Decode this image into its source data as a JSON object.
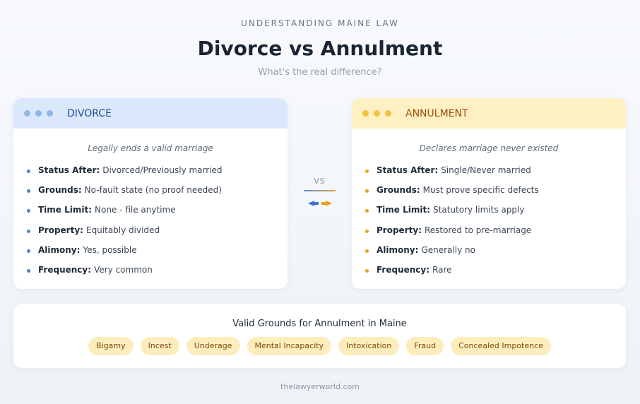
{
  "header": {
    "eyebrow": "UNDERSTANDING MAINE LAW",
    "title": "Divorce vs Annulment",
    "subtitle": "What's the real difference?"
  },
  "divorce": {
    "name": "DIVORCE",
    "tagline": "Legally ends a valid marriage",
    "rows": [
      {
        "label": "Status After",
        "value": "Divorced/Previously married"
      },
      {
        "label": "Grounds",
        "value": "No-fault state (no proof needed)"
      },
      {
        "label": "Time Limit",
        "value": "None - file anytime"
      },
      {
        "label": "Property",
        "value": "Equitably divided"
      },
      {
        "label": "Alimony",
        "value": "Yes, possible"
      },
      {
        "label": "Frequency",
        "value": "Very common"
      }
    ]
  },
  "annulment": {
    "name": "ANNULMENT",
    "tagline": "Declares marriage never existed",
    "rows": [
      {
        "label": "Status After",
        "value": "Single/Never married"
      },
      {
        "label": "Grounds",
        "value": "Must prove specific defects"
      },
      {
        "label": "Time Limit",
        "value": "Statutory limits apply"
      },
      {
        "label": "Property",
        "value": "Restored to pre-marriage"
      },
      {
        "label": "Alimony",
        "value": "Generally no"
      },
      {
        "label": "Frequency",
        "value": "Rare"
      }
    ]
  },
  "versus": {
    "label": "VS",
    "icon": "swap-arrows-icon"
  },
  "grounds": {
    "title": "Valid Grounds for Annulment in Maine",
    "items": [
      "Bigamy",
      "Incest",
      "Underage",
      "Mental Incapacity",
      "Intoxication",
      "Fraud",
      "Concealed Impotence"
    ]
  },
  "footer": {
    "source": "thelawyerworld.com"
  },
  "colors": {
    "divorce_accent": "#1e4c9a",
    "divorce_header": "#dbe8fb",
    "annulment_accent": "#a04e0a",
    "annulment_header": "#fdf0c2",
    "chip_background": "#fdedbc"
  }
}
